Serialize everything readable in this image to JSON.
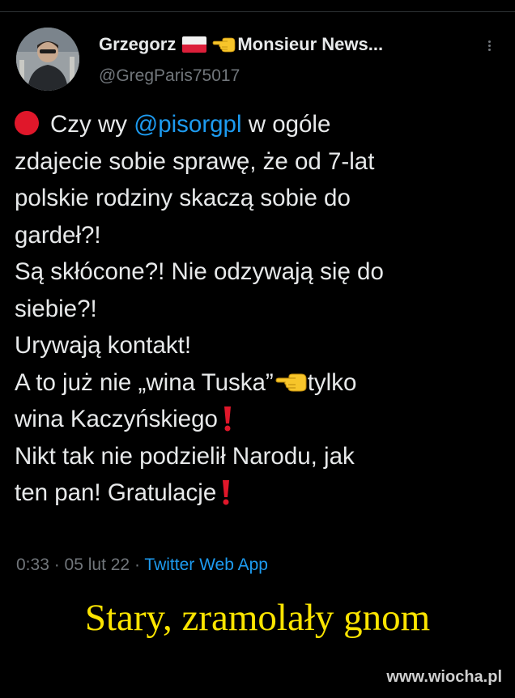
{
  "author": {
    "display_name": "Grzegorz",
    "display_name_suffix": "Monsieur News...",
    "handle": "@GregParis75017",
    "flag_icon": "poland-flag-icon",
    "pointing_icon": "backhand-index-pointing-left-icon",
    "avatar_icon": "profile-photo-avatar"
  },
  "tweet": {
    "lines": {
      "l1_before": "Czy wy ",
      "l1_mention": "@pisorgpl",
      "l1_after": " w ogóle",
      "l2": "zdajecie sobie sprawę, że od 7-lat",
      "l3": "polskie rodziny skaczą sobie do",
      "l4": "gardeł?!",
      "l5": "Są skłócone?! Nie odzywają się do",
      "l6": "siebie?!",
      "l7": "Urywają kontakt!",
      "l8_before": "A to już nie „wina Tuska”",
      "l8_after": "tylko",
      "l9": "wina Kaczyńskiego",
      "l10": "Nikt tak nie podzielił Narodu, jak",
      "l11": "ten pan! Gratulacje"
    },
    "icons": {
      "lead": "red-circle-icon",
      "pointer": "backhand-index-pointing-left-icon",
      "exclamation": "red-exclamation-icon"
    }
  },
  "meta": {
    "time": "0:33",
    "separator": " · ",
    "date": "05 lut 22",
    "source": "Twitter Web App"
  },
  "caption": "Stary, zramolały gnom",
  "watermark": "www.wiocha.pl",
  "colors": {
    "background": "#000000",
    "text": "#e7e9ea",
    "muted": "#71767b",
    "link": "#1d9bf0",
    "caption": "#fbe400",
    "red_emoji": "#e0172a"
  }
}
